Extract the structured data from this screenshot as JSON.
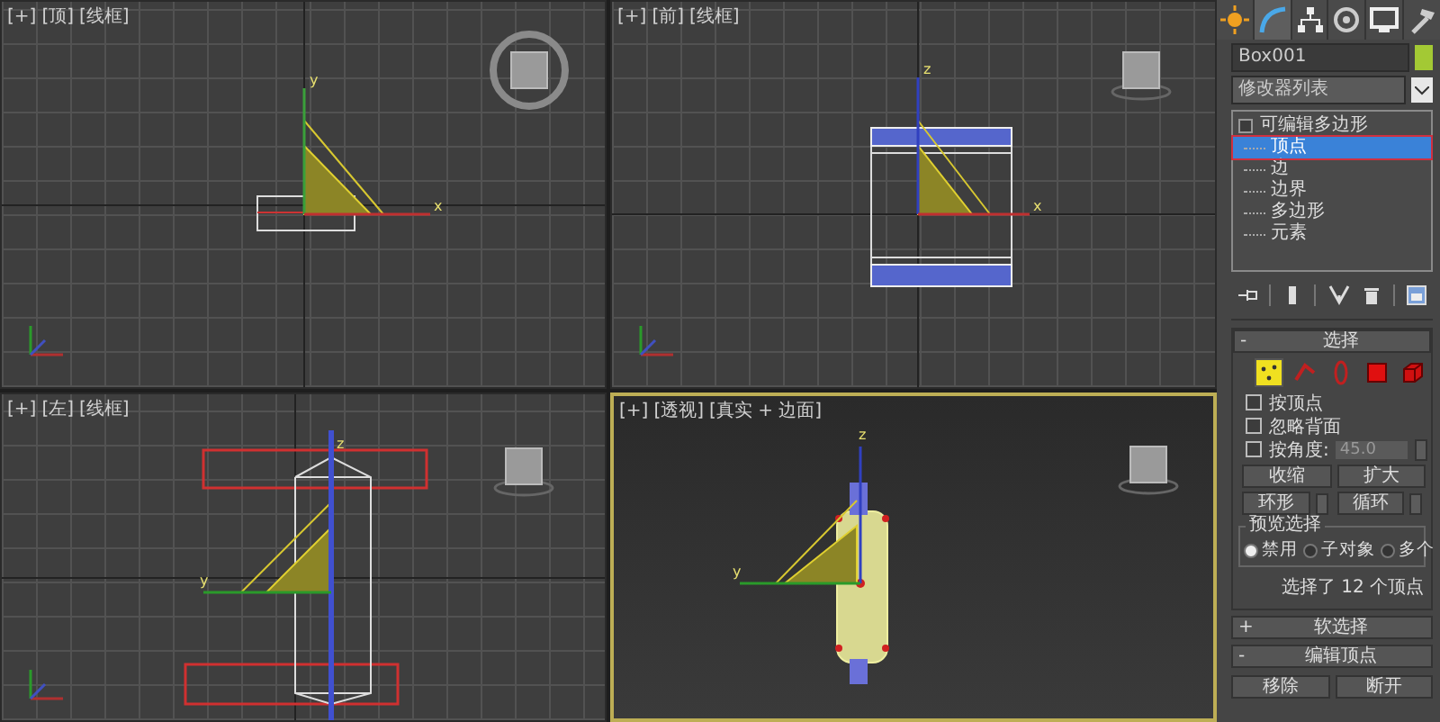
{
  "viewports": [
    {
      "kind": "top",
      "active": false,
      "labels": [
        "[+]",
        "[顶]",
        "[线框]"
      ],
      "axis_labels": [
        "y",
        "x"
      ]
    },
    {
      "kind": "front",
      "active": false,
      "labels": [
        "[+]",
        "[前]",
        "[线框]"
      ],
      "axis_labels": [
        "z",
        "x"
      ]
    },
    {
      "kind": "left",
      "active": false,
      "labels": [
        "[+]",
        "[左]",
        "[线框]"
      ],
      "axis_labels": [
        "z",
        "y"
      ]
    },
    {
      "kind": "perspective",
      "active": true,
      "labels": [
        "[+]",
        "[透视]",
        "[真实 + 边面]"
      ],
      "axis_labels": [
        "z",
        "y"
      ]
    }
  ],
  "command_tabs": [
    {
      "kind": "create",
      "selected": false
    },
    {
      "kind": "modify",
      "selected": true
    },
    {
      "kind": "hierarchy",
      "selected": false
    },
    {
      "kind": "motion",
      "selected": false
    },
    {
      "kind": "display",
      "selected": false
    },
    {
      "kind": "utilities",
      "selected": false
    }
  ],
  "object_name": "Box001",
  "modifier_list": "修改器列表",
  "stack": [
    {
      "label": "可编辑多边形",
      "expanded": true,
      "selected": false,
      "children": [
        {
          "label": "顶点",
          "selected": true
        },
        {
          "label": "边",
          "selected": false
        },
        {
          "label": "边界",
          "selected": false
        },
        {
          "label": "多边形",
          "selected": false
        },
        {
          "label": "元素",
          "selected": false
        }
      ]
    }
  ],
  "selection": {
    "sign": "-",
    "title": "选择",
    "subobjects": [
      {
        "kind": "vertex",
        "selected": true
      },
      {
        "kind": "edge",
        "selected": false
      },
      {
        "kind": "border",
        "selected": false
      },
      {
        "kind": "polygon",
        "selected": false
      },
      {
        "kind": "element",
        "selected": false
      }
    ],
    "checkboxes": [
      {
        "label": "按顶点",
        "checked": false
      },
      {
        "label": "忽略背面",
        "checked": false
      },
      {
        "label": "按角度:",
        "checked": false
      }
    ],
    "angle_value": "45.0",
    "buttons": [
      "收缩",
      "扩大"
    ],
    "spinner_buttons": [
      "环形",
      "循环"
    ],
    "preview": {
      "title": "预览选择",
      "options": [
        {
          "label": "禁用",
          "selected": true
        },
        {
          "label": "子对象",
          "selected": false
        },
        {
          "label": "多个",
          "selected": false
        }
      ]
    },
    "status": "选择了 12 个顶点"
  },
  "rollouts": [
    {
      "sign": "+",
      "title": "软选择"
    },
    {
      "sign": "-",
      "title": "编辑顶点"
    }
  ],
  "edit_buttons": [
    "移除",
    "断开"
  ]
}
